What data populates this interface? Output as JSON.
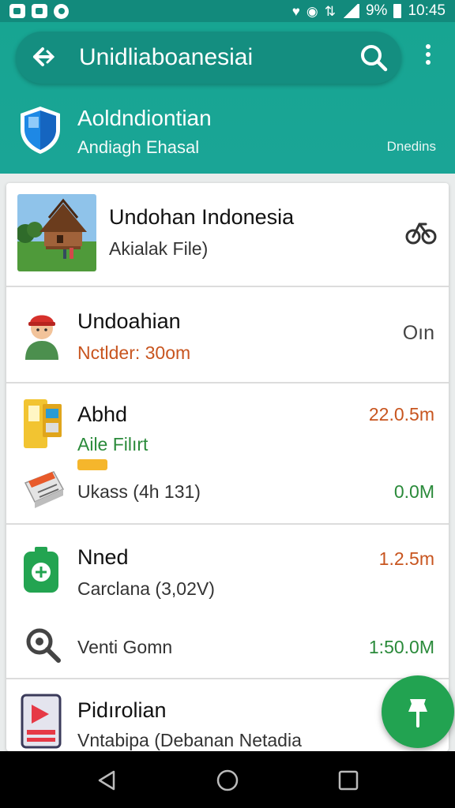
{
  "status_bar": {
    "percent": "9%",
    "time": "10:45"
  },
  "toolbar": {
    "title": "Unidliaboanesiai"
  },
  "header": {
    "title": "Aoldndiontian",
    "subtitle": "Andiagh Ehasal",
    "right_label": "Dnedins"
  },
  "list": {
    "items": [
      {
        "title": "Undohan Indonesia",
        "subtitle": "Akialak File)",
        "icon": "bicycle-icon"
      },
      {
        "title": "Undoahian",
        "subtitle": "Nctlder: 30om",
        "value": "Oın"
      },
      {
        "title": "Abhd",
        "subtitle": "Aile Filırt",
        "value": "22.0.5m",
        "badge": "",
        "sub_line": {
          "text": "Ukass (4h 131)",
          "value": "0.0M"
        }
      },
      {
        "title": "Nned",
        "subtitle": "Carclana (3,02V)",
        "value": "1.2.5m",
        "sub_line": {
          "text": "Venti Gomn",
          "value": "1:50.0M"
        }
      },
      {
        "title": "Pidırolian",
        "subtitle": "Vntabipa (Debanan Netadia"
      }
    ]
  },
  "colors": {
    "teal_header": "#1aa596",
    "teal_status": "#128a7c",
    "fab_green": "#22a351",
    "value_orange": "#c8551f",
    "value_green": "#2a8a3a"
  }
}
